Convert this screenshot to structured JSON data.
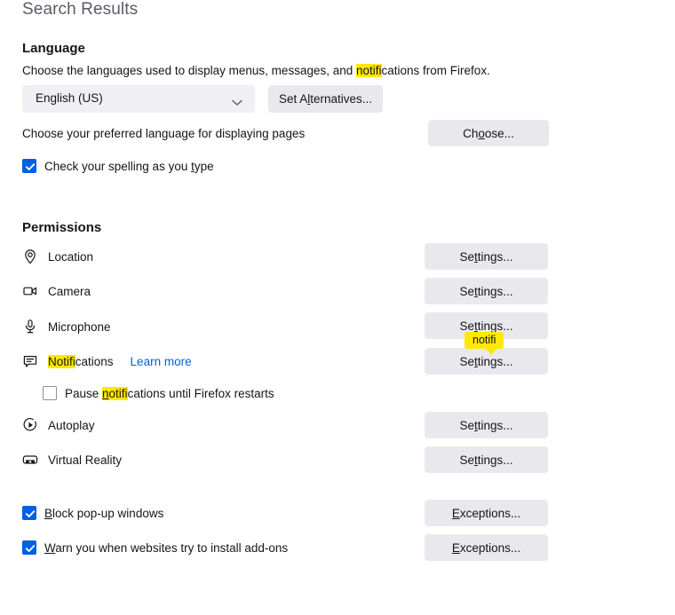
{
  "page": {
    "title": "Search Results"
  },
  "language": {
    "heading": "Language",
    "description_pre": "Choose the languages used to display menus, messages, and ",
    "description_highlight": "notifi",
    "description_post": "cations from Firefox.",
    "selected_language": "English (US)",
    "set_alternatives_label_pre": "Set A",
    "set_alternatives_label_key": "l",
    "set_alternatives_label_post": "ternatives...",
    "preferred_language_description": "Choose your preferred language for displaying pages",
    "choose_label_pre": "Ch",
    "choose_label_key": "o",
    "choose_label_post": "ose...",
    "spellcheck_label_pre": "Check your spelling as you ",
    "spellcheck_label_key": "t",
    "spellcheck_label_post": "ype",
    "spellcheck_checked": true
  },
  "permissions": {
    "heading": "Permissions",
    "rows": [
      {
        "icon": "location-icon",
        "label": "Location",
        "button": "Settings..."
      },
      {
        "icon": "camera-icon",
        "label": "Camera",
        "button": "Settings..."
      },
      {
        "icon": "microphone-icon",
        "label": "Microphone",
        "button": "Settings..."
      },
      {
        "icon": "notifications-icon",
        "label_highlight": "Notifi",
        "label_rest": "cations",
        "link": "Learn more",
        "button": "Settings..."
      },
      {
        "icon": "autoplay-icon",
        "label": "Autoplay",
        "button": "Settings..."
      },
      {
        "icon": "virtual-reality-icon",
        "label": "Virtual Reality",
        "button": "Settings..."
      }
    ],
    "pause_checkbox": {
      "checked": false,
      "label_pre": "Pause ",
      "label_key": "n",
      "label_highlight_rest": "otifi",
      "label_post": "cations until Firefox restarts"
    },
    "block_popups": {
      "checked": true,
      "label_key": "B",
      "label_post": "lock pop-up windows",
      "button_key": "E",
      "button_post": "xceptions..."
    },
    "warn_addons": {
      "checked": true,
      "label_key": "W",
      "label_post": "arn you when websites try to install add-ons",
      "button_key": "E",
      "button_post": "xceptions..."
    },
    "settings_button_key": "t",
    "settings_button_pre": "Se",
    "settings_button_post": "tings..."
  },
  "tooltip": {
    "text": "notifi"
  },
  "colors": {
    "accent_blue": "#0060df",
    "highlight_yellow": "#ffe900",
    "button_bg": "#e9e9ed",
    "dropdown_bg": "#f0f0f4",
    "text": "#15141a",
    "title_gray": "#5b5b66"
  }
}
